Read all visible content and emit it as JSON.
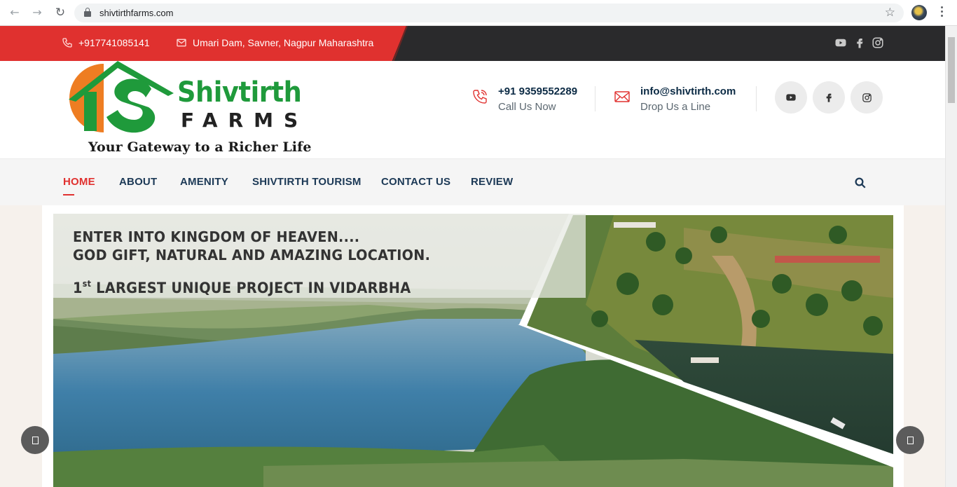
{
  "browser": {
    "url": "shivtirthfarms.com",
    "back_icon": "arrow-left-icon",
    "forward_icon": "arrow-right-icon",
    "reload_icon": "reload-icon",
    "bookmark_icon": "star-icon"
  },
  "topbar": {
    "phone": "+917741085141",
    "address": "Umari Dam, Savner, Nagpur Maharashtra",
    "social": [
      "youtube-icon",
      "facebook-icon",
      "instagram-icon"
    ],
    "colors": {
      "accent": "#e0312f",
      "dark": "#2a2a2c"
    }
  },
  "header": {
    "logo": {
      "brand_line1": "Shivtirth",
      "brand_line2": "FARMS",
      "tagline": "Your Gateway to a Richer Life"
    },
    "call": {
      "main": "+91 9359552289",
      "sub": "Call Us Now"
    },
    "mail": {
      "main": "info@shivtirth.com",
      "sub": "Drop Us a Line"
    },
    "social": [
      "youtube-icon",
      "facebook-icon",
      "instagram-icon"
    ]
  },
  "nav": {
    "items": [
      {
        "label": "HOME",
        "active": true
      },
      {
        "label": "ABOUT"
      },
      {
        "label": "AMENITY"
      },
      {
        "label": "SHIVTIRTH TOURISM"
      },
      {
        "label": "CONTACT US"
      },
      {
        "label": "REVIEW"
      }
    ],
    "search_icon": "search-icon"
  },
  "hero": {
    "line1": "ENTER INTO KINGDOM OF HEAVEN....",
    "line2": "GOD GIFT, NATURAL AND AMAZING LOCATION.",
    "line3_num": "1",
    "line3_sup": "st",
    "line3_rest": " LARGEST UNIQUE PROJECT IN VIDARBHA"
  },
  "slider": {
    "prev_icon": "slider-prev-icon",
    "next_icon": "slider-next-icon"
  }
}
